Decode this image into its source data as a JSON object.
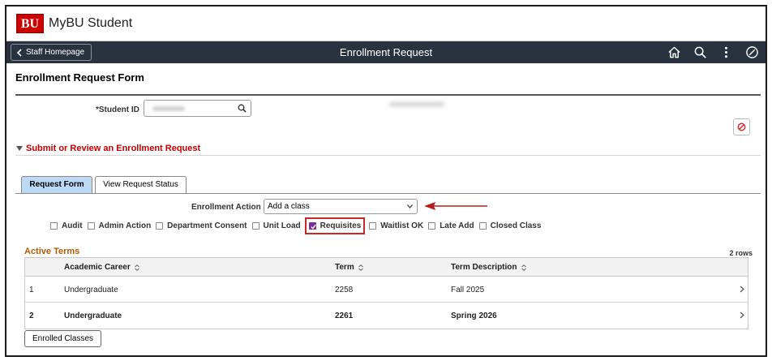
{
  "brand": {
    "logo_text": "BU",
    "title": "MyBU Student"
  },
  "navbar": {
    "back_label": "Staff Homepage",
    "title": "Enrollment Request",
    "icons": [
      "home-icon",
      "search-icon",
      "more-vertical-icon",
      "nav-bar-icon"
    ]
  },
  "page": {
    "title": "Enrollment Request Form"
  },
  "student": {
    "id_label": "*Student ID",
    "id_value": ""
  },
  "section": {
    "title": "Submit or Review an Enrollment Request"
  },
  "tabs": [
    {
      "label": "Request Form",
      "active": true
    },
    {
      "label": "View Request Status",
      "active": false
    }
  ],
  "enrollment_action": {
    "label": "Enrollment Action",
    "value": "Add a class"
  },
  "checkboxes": [
    {
      "label": "Audit",
      "checked": false
    },
    {
      "label": "Admin Action",
      "checked": false
    },
    {
      "label": "Department Consent",
      "checked": false
    },
    {
      "label": "Unit Load",
      "checked": false
    },
    {
      "label": "Requisites",
      "checked": true
    },
    {
      "label": "Waitlist OK",
      "checked": false
    },
    {
      "label": "Late Add",
      "checked": false
    },
    {
      "label": "Closed Class",
      "checked": false
    }
  ],
  "active_terms": {
    "title": "Active Terms",
    "row_count": "2 rows",
    "columns": [
      "Academic Career",
      "Term",
      "Term Description"
    ],
    "rows": [
      {
        "num": "1",
        "career": "Undergraduate",
        "term": "2258",
        "description": "Fall 2025",
        "bold": false
      },
      {
        "num": "2",
        "career": "Undergraduate",
        "term": "2261",
        "description": "Spring 2026",
        "bold": true
      }
    ]
  },
  "footer": {
    "enrolled_label": "Enrolled Classes"
  },
  "colors": {
    "nav_bg": "#28333f",
    "brand_red": "#cc0000",
    "section_red": "#c00000",
    "tab_active": "#bcd9f5",
    "checkbox_checked": "#7b2d96",
    "active_terms_title": "#b35900"
  }
}
